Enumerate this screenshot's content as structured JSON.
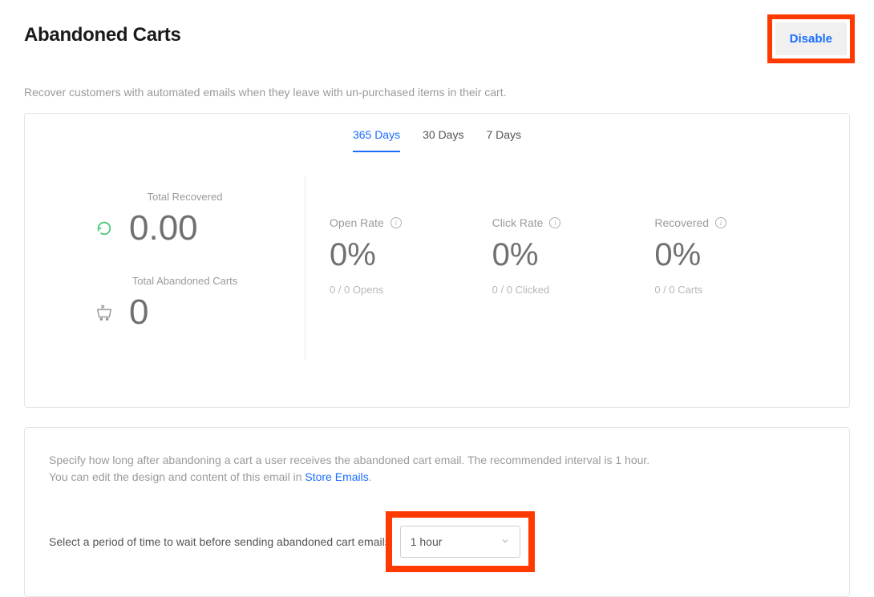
{
  "header": {
    "title": "Abandoned Carts",
    "disable_label": "Disable"
  },
  "subtitle": "Recover customers with automated emails when they leave with un-purchased items in their cart.",
  "tabs": [
    {
      "label": "365 Days",
      "active": true
    },
    {
      "label": "30 Days",
      "active": false
    },
    {
      "label": "7 Days",
      "active": false
    }
  ],
  "summary": {
    "total_recovered_label": "Total Recovered",
    "total_recovered_value": "0.00",
    "total_abandoned_label": "Total Abandoned Carts",
    "total_abandoned_value": "0"
  },
  "metrics": {
    "open_rate": {
      "label": "Open Rate",
      "value": "0%",
      "sub": "0 / 0 Opens"
    },
    "click_rate": {
      "label": "Click Rate",
      "value": "0%",
      "sub": "0 / 0 Clicked"
    },
    "recovered": {
      "label": "Recovered",
      "value": "0%",
      "sub": "0 / 0 Carts"
    }
  },
  "settings": {
    "help_line1": "Specify how long after abandoning a cart a user receives the abandoned cart email. The recommended interval is 1 hour.",
    "help_line2_prefix": "You can edit the design and content of this email in ",
    "help_line2_link": "Store Emails",
    "help_line2_suffix": ".",
    "select_label": "Select a period of time to wait before sending abandoned cart emails",
    "select_value": "1 hour"
  }
}
